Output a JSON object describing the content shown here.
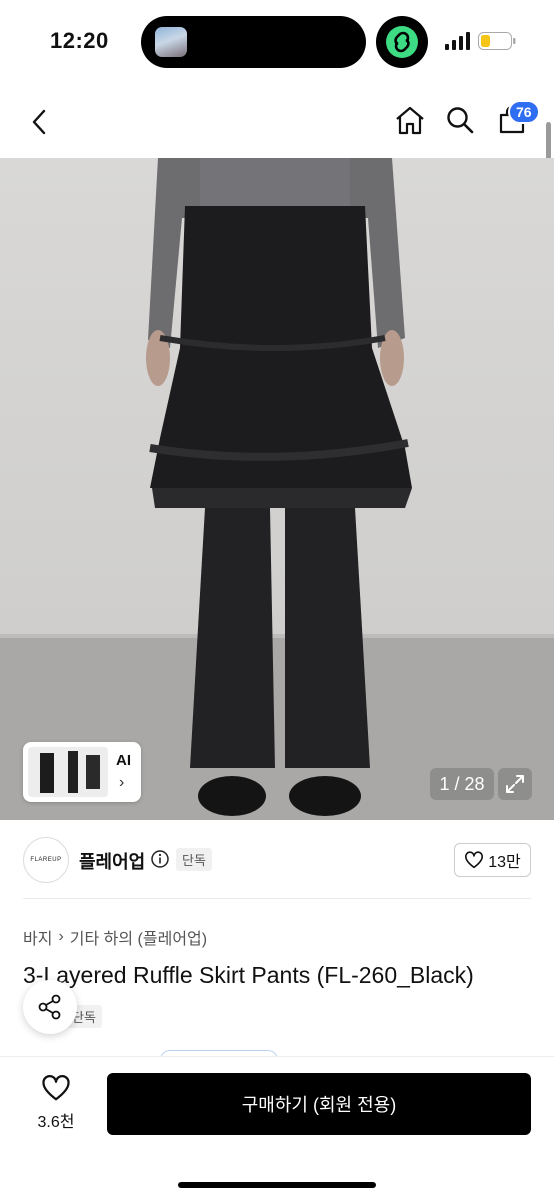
{
  "status": {
    "time": "12:20"
  },
  "nav": {
    "cart_count": "76",
    "icons": [
      "back-icon",
      "home-icon",
      "search-icon",
      "cart-icon"
    ]
  },
  "gallery": {
    "counter": "1 / 28",
    "ai_label": "AI",
    "ai_chevron": "›"
  },
  "shop": {
    "logo_text": "FLAREUP",
    "name": "플레어업",
    "tag": "단독",
    "likes": "13만"
  },
  "breadcrumb": {
    "category": "바지",
    "separator": "›",
    "subcategory": "기타 하의 (플레어업)"
  },
  "product": {
    "title": "3-Layered Ruffle Skirt Pants (FL-260_Black)",
    "tag": "단독"
  },
  "bottom": {
    "wish_count": "3.6천",
    "buy_label": "구매하기 (회원 전용)"
  },
  "colors": {
    "badge": "#2f6df2",
    "buy_button": "#000000",
    "green_app": "#3ddc84"
  }
}
